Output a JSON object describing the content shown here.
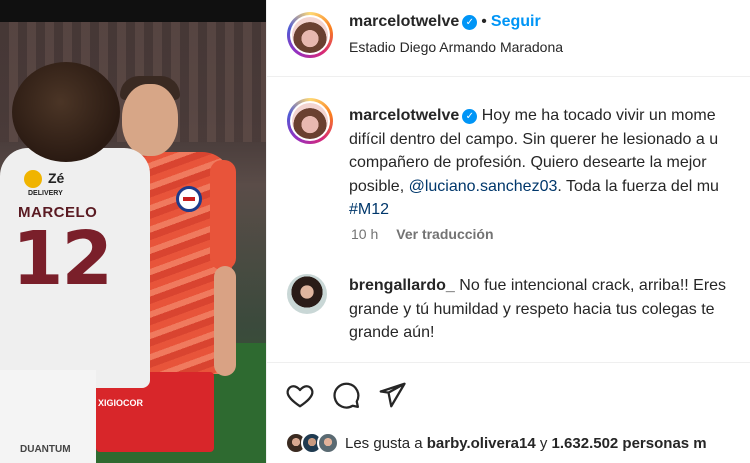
{
  "header": {
    "username": "marcelotwelve",
    "follow_label": "Seguir",
    "location": "Estadio Diego Armando Maradona"
  },
  "photo": {
    "jersey_name": "MARCELO",
    "jersey_number": "12",
    "sponsor_name": "Zé",
    "sponsor_sub": "DELIVERY",
    "shorts_text": "XIGIOCOR",
    "shorts_text2": "DUANTUM"
  },
  "caption": {
    "username": "marcelotwelve",
    "line1": "Hoy me ha tocado vivir un mome",
    "line2": "difícil dentro del campo. Sin querer he lesionado a u",
    "line3": "compañero de profesión. Quiero desearte la mejor",
    "line4_before": "posible, ",
    "mention": "@luciano.sanchez03",
    "line4_after": ". Toda la fuerza del mu",
    "hashtag": "#M12",
    "time": "10 h",
    "translate": "Ver traducción"
  },
  "comment": {
    "username": "brengallardo_",
    "line1": "No fue intencional crack, arriba!! Eres",
    "line2": "grande y tú humildad y respeto hacia tus colegas te",
    "line3": "grande aún!"
  },
  "actions": {
    "icons": [
      "heart-icon",
      "comment-icon",
      "share-icon"
    ]
  },
  "likes": {
    "prefix": "Les gusta a ",
    "user": "barby.olivera14",
    "middle": " y ",
    "count": "1.632.502 personas m"
  },
  "colors": {
    "accent": "#0095f6",
    "link": "#00376b",
    "muted": "#737373",
    "text": "#262626"
  }
}
